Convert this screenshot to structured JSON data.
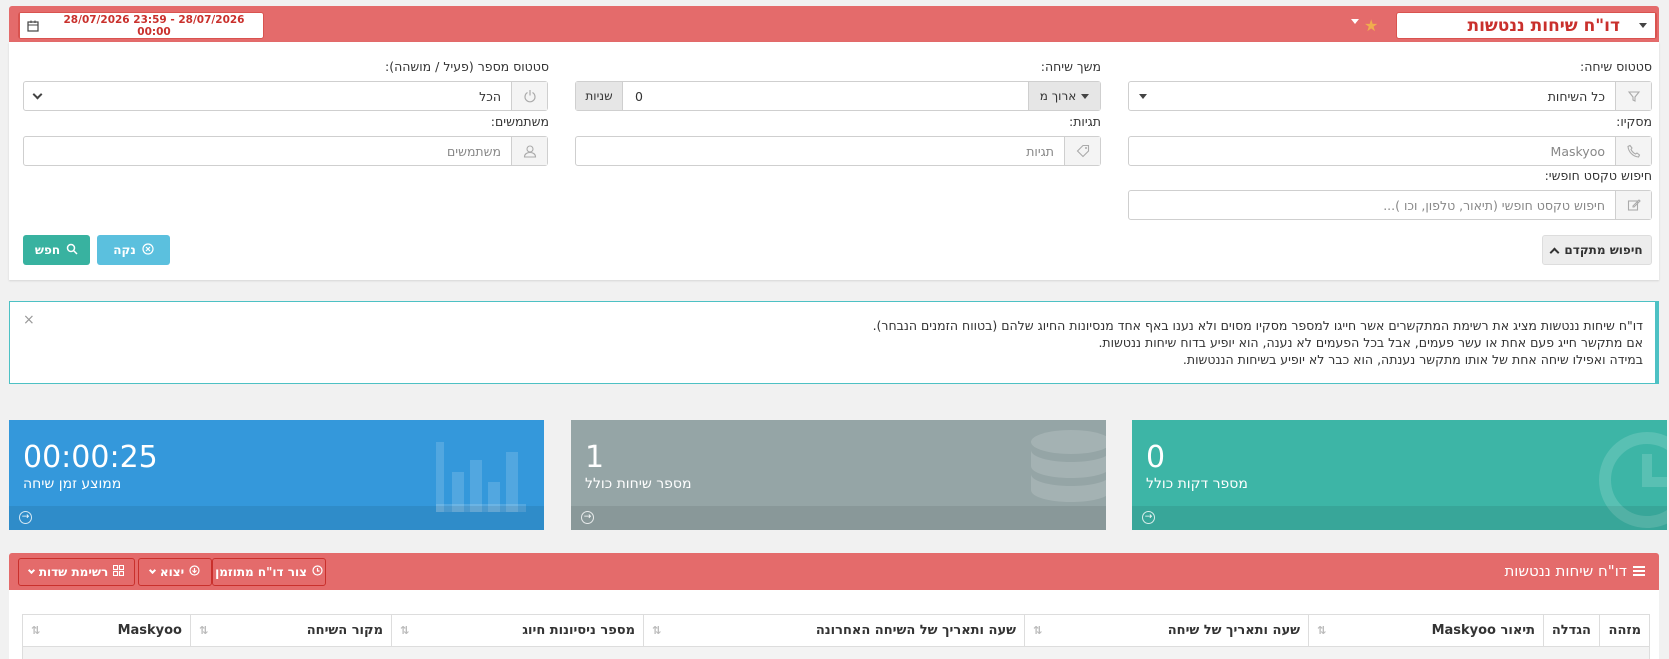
{
  "header": {
    "title": "דו\"ח שיחות ננטשות",
    "date_range": "28/07/2026 23:59 - 28/07/2026 00:00"
  },
  "filters": {
    "call_status": {
      "label": "סטטוס שיחה:",
      "value": "כל השיחות"
    },
    "call_duration": {
      "label": "משך שיחה:",
      "operator": "ארוך מ",
      "value": "0",
      "unit": "שניות"
    },
    "number_status": {
      "label": "סטטוס מספר (פעיל / מושהה):",
      "value": "הכל"
    },
    "maskyoo": {
      "label": "מסקיו:",
      "placeholder": "Maskyoo"
    },
    "tags": {
      "label": "תגיות:",
      "placeholder": "תגיות"
    },
    "users": {
      "label": "משתמשים:",
      "placeholder": "משתמשים"
    },
    "free_text": {
      "label": "חיפוש טקסט חופשי:",
      "placeholder": "חיפוש טקסט חופשי (תיאור, טלפון, וכו )..."
    },
    "buttons": {
      "search": "חפש",
      "clear": "נקה",
      "advanced": "חיפוש מתקדם"
    }
  },
  "alert": {
    "lines": [
      "דו\"ח שיחות ננטשות מציג את רשימת המתקשרים אשר חייגו למספר מסקיו מסוים ולא נענו באף אחד מנסיונות החיוג שלהם (בטווח הזמנים הנבחר).",
      "אם מתקשר חייג פעם אחת או עשר פעמים, אבל בכל הפעמים לא נענה, הוא יופיע בדוח שיחות ננטשות.",
      "במידה ואפילו שיחה אחת של אותו מתקשר נענתה, הוא כבר לא יופיע בשיחות הננטשות."
    ],
    "close": "×"
  },
  "stats": {
    "avg_time": {
      "value": "00:00:25",
      "caption": "ממוצע זמן שיחה"
    },
    "total_calls": {
      "value": "1",
      "caption": "מספר שיחות כולל"
    },
    "total_minutes": {
      "value": "0",
      "caption": "מספר דקות כולל"
    }
  },
  "report": {
    "title": "דו\"ח שיחות ננטשות",
    "buttons": {
      "scheduled": "צור דו\"ח מתוזמן",
      "export": "יצוא",
      "fields": "רשימת שדות"
    },
    "columns": [
      "מזהה",
      "הגדלה",
      "תיאור Maskyoo",
      "שעה ותאריך של שיחה",
      "שעה ותאריך של השיחה האחרונה",
      "מספר ניסיונות חיוג",
      "מקור השיחה",
      "Maskyoo"
    ]
  },
  "colors": {
    "header_red": "#e46b6b",
    "teal": "#38b2a0",
    "blue": "#3498db",
    "grey": "#95a5a6"
  }
}
